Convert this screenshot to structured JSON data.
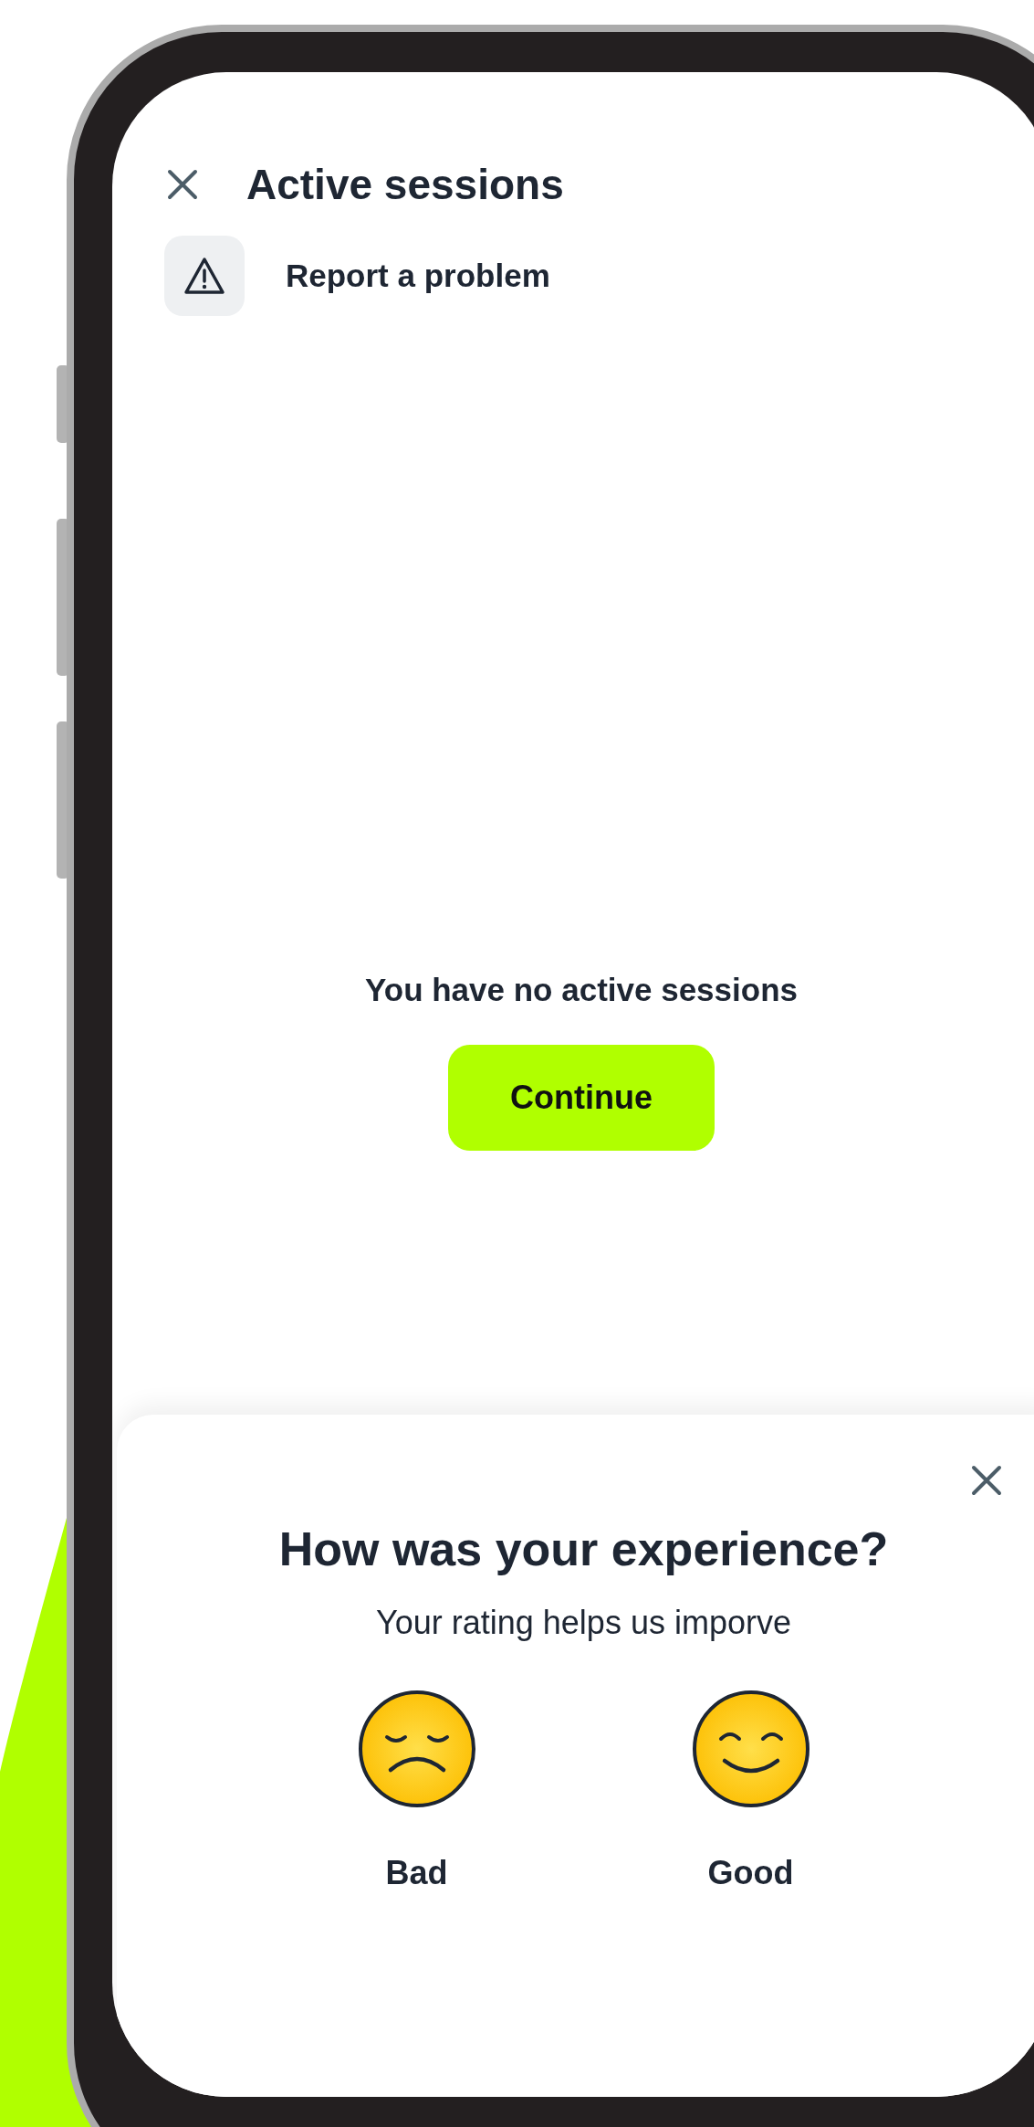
{
  "header": {
    "title": "Active sessions"
  },
  "report": {
    "label": "Report a problem"
  },
  "empty_state": {
    "message": "You have no active sessions",
    "button": "Continue"
  },
  "feedback_sheet": {
    "heading": "How was your experience?",
    "subtitle": "Your rating helps us imporve",
    "options": [
      {
        "kind": "bad",
        "label": "Bad"
      },
      {
        "kind": "good",
        "label": "Good"
      }
    ]
  }
}
